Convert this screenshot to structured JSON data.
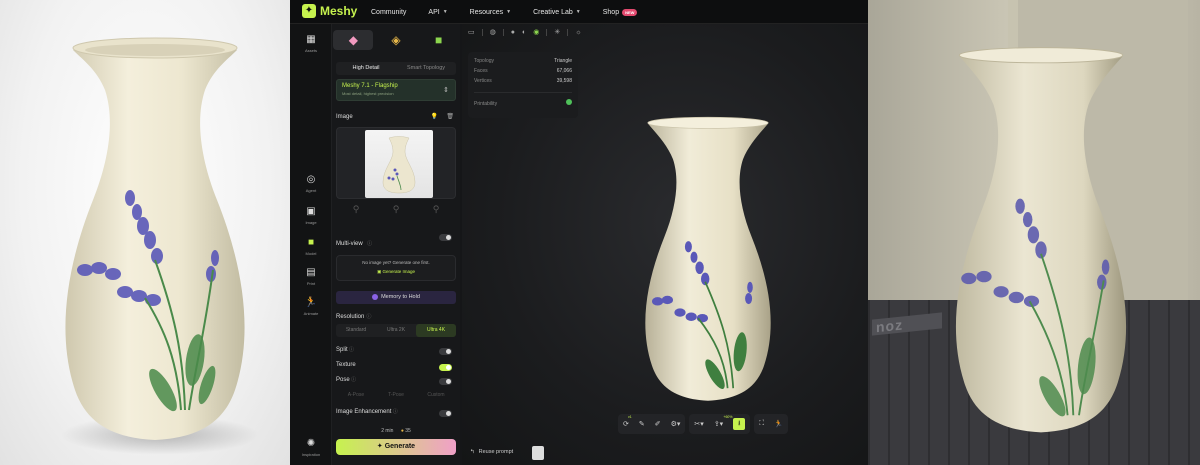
{
  "app": {
    "logo_text": "Meshy",
    "nav": [
      {
        "label": "Community",
        "caret": false
      },
      {
        "label": "API",
        "caret": true
      },
      {
        "label": "Resources",
        "caret": true
      },
      {
        "label": "Creative Lab",
        "caret": true
      },
      {
        "label": "Shop",
        "caret": false,
        "badge": "NEW"
      }
    ]
  },
  "rail": {
    "items": [
      {
        "label": "Assets",
        "icon": "grid-icon",
        "glyph": "▦"
      },
      {
        "label": "Agent",
        "icon": "agent-icon",
        "glyph": "◎"
      },
      {
        "label": "Image",
        "icon": "image-icon",
        "glyph": "▣"
      },
      {
        "label": "Model",
        "icon": "cube-icon",
        "glyph": "■"
      },
      {
        "label": "Print",
        "icon": "printer-icon",
        "glyph": "▤"
      },
      {
        "label": "Animate",
        "icon": "running-icon",
        "glyph": "🏃"
      },
      {
        "label": "Inspiration",
        "icon": "sparkle-icon",
        "glyph": "✺"
      }
    ]
  },
  "panel": {
    "detail_options": [
      "High Detail",
      "Smart Topology"
    ],
    "model_name": "Meshy 7.1 - Flagship",
    "model_sub": "Most detail, highest precision",
    "image_label": "Image",
    "multiview_label": "Multi-view",
    "no_image_text": "No image yet? Generate one first.",
    "generate_image_link": "Generate Image",
    "memory_label": "Memory to Hold",
    "resolution_label": "Resolution",
    "resolution_options": [
      "Standard",
      "Ultra 2K",
      "Ultra 4K"
    ],
    "split_label": "Split",
    "texture_label": "Texture",
    "pose_label": "Pose",
    "pose_options": [
      "A-Pose",
      "T-Pose",
      "Custom"
    ],
    "enhancement_label": "Image Enhancement",
    "time": "2 min",
    "credits": "35",
    "generate_label": "Generate"
  },
  "viewport": {
    "stats": [
      {
        "label": "Topology",
        "value": "Triangle"
      },
      {
        "label": "Faces",
        "value": "67,066"
      },
      {
        "label": "Vertices",
        "value": "39,598"
      }
    ],
    "printability_label": "Printability",
    "reuse_prompt": "Reuse prompt",
    "toolbar_badge_1": "v1",
    "toolbar_badge_2": "+60%"
  },
  "colors": {
    "accent": "#c6f24e",
    "vase_body": "#ece6cf",
    "lavender": "#5a58b8",
    "leaf": "#4a8a4a"
  }
}
